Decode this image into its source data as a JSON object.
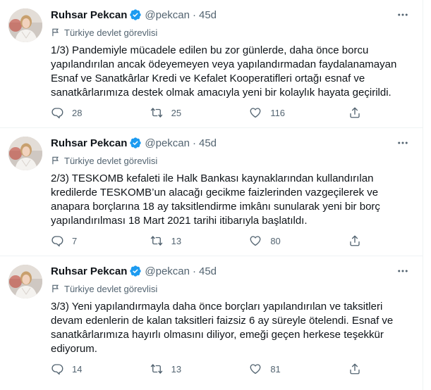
{
  "tweets": [
    {
      "name": "Ruhsar Pekcan",
      "handle": "@pekcan",
      "dot": "·",
      "time": "45d",
      "label": "Türkiye devlet görevlisi",
      "text": "1/3) Pandemiyle mücadele edilen bu zor günlerde, daha önce borcu yapılandırılan ancak ödeyemeyen veya yapılandırmadan faydalanamayan Esnaf ve Sanatkârlar Kredi ve Kefalet Kooperatifleri ortağı esnaf ve sanatkârlarımıza destek olmak amacıyla yeni bir kolaylık hayata geçirildi.",
      "replies": "28",
      "retweets": "25",
      "likes": "116"
    },
    {
      "name": "Ruhsar Pekcan",
      "handle": "@pekcan",
      "dot": "·",
      "time": "45d",
      "label": "Türkiye devlet görevlisi",
      "text": "2/3) TESKOMB kefaleti ile Halk Bankası kaynaklarından kullandırılan kredilerde TESKOMB’un alacağı gecikme faizlerinden vazgeçilerek ve anapara borçlarına 18 ay taksitlendirme imkânı sunularak yeni bir borç yapılandırılması 18 Mart 2021 tarihi itibarıyla başlatıldı.",
      "replies": "7",
      "retweets": "13",
      "likes": "80"
    },
    {
      "name": "Ruhsar Pekcan",
      "handle": "@pekcan",
      "dot": "·",
      "time": "45d",
      "label": "Türkiye devlet görevlisi",
      "text": "3/3) Yeni yapılandırmayla daha önce borçları yapılandırılan ve taksitleri devam edenlerin de kalan taksitleri faizsiz 6 ay süreyle ötelendi. Esnaf ve sanatkârlarımıza hayırlı olmasını diliyor, emeği geçen herkese teşekkür ediyorum.",
      "replies": "14",
      "retweets": "13",
      "likes": "81"
    }
  ],
  "icons": {
    "verified": "verified-badge-icon",
    "more": "more-options-icon",
    "label": "government-flag-icon",
    "reply": "reply-icon",
    "retweet": "retweet-icon",
    "like": "heart-icon",
    "share": "share-icon"
  },
  "colors": {
    "verified": "#1d9bf0",
    "text": "#0f1419",
    "secondary": "#536471"
  }
}
